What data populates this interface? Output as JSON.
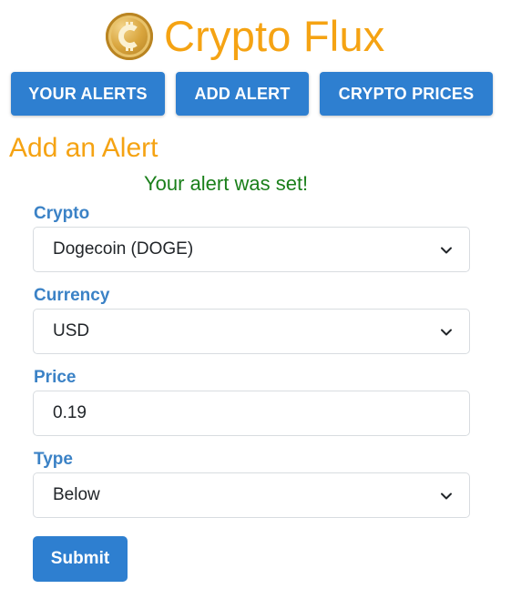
{
  "header": {
    "title": "Crypto Flux",
    "logo_icon": "bitcoin-coin-icon"
  },
  "nav": {
    "your_alerts": "YOUR ALERTS",
    "add_alert": "ADD ALERT",
    "crypto_prices": "CRYPTO PRICES"
  },
  "form": {
    "title": "Add an Alert",
    "success_message": "Your alert was set!",
    "crypto": {
      "label": "Crypto",
      "value": "Dogecoin (DOGE)"
    },
    "currency": {
      "label": "Currency",
      "value": "USD"
    },
    "price": {
      "label": "Price",
      "value": "0.19"
    },
    "type": {
      "label": "Type",
      "value": "Below"
    },
    "submit_label": "Submit"
  },
  "colors": {
    "brand_orange": "#f5a313",
    "primary_blue": "#2e7fd0",
    "label_blue": "#3b82c6",
    "success_green": "#1a7f1a"
  }
}
